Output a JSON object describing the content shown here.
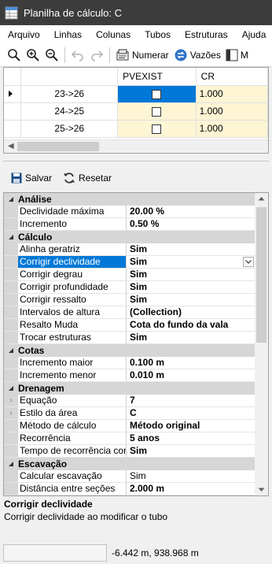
{
  "window": {
    "title": "Planilha de cálculo: C"
  },
  "menu": [
    "Arquivo",
    "Linhas",
    "Colunas",
    "Tubos",
    "Estruturas",
    "Ajuda"
  ],
  "toolbar": {
    "numerar_label": "Numerar",
    "vazoes_label": "Vazões",
    "m_label": "M"
  },
  "grid": {
    "columns": [
      "PVEXIST",
      "CR"
    ],
    "rows": [
      {
        "name": "23->26",
        "cr": "1.000"
      },
      {
        "name": "24->25",
        "cr": "1.000"
      },
      {
        "name": "25->26",
        "cr": "1.000"
      }
    ]
  },
  "actions": {
    "save_label": "Salvar",
    "reset_label": "Resetar"
  },
  "properties": {
    "analise": {
      "title": "Análise",
      "items": [
        {
          "name": "Declividade máxima",
          "value": "20.00 %"
        },
        {
          "name": "Incremento",
          "value": "0.50 %"
        }
      ]
    },
    "calculo": {
      "title": "Cálculo",
      "items": [
        {
          "name": "Alinha geratriz",
          "value": "Sim"
        },
        {
          "name": "Corrigir declividade",
          "value": "Sim"
        },
        {
          "name": "Corrigir degrau",
          "value": "Sim"
        },
        {
          "name": "Corrigir profundidade",
          "value": "Sim"
        },
        {
          "name": "Corrigir ressalto",
          "value": "Sim"
        },
        {
          "name": "Intervalos de altura",
          "value": "(Collection)"
        },
        {
          "name": "Resalto Muda",
          "value": "Cota do fundo da vala"
        },
        {
          "name": "Trocar estruturas",
          "value": "Sim"
        }
      ]
    },
    "cotas": {
      "title": "Cotas",
      "items": [
        {
          "name": "Incremento maior",
          "value": "0.100 m"
        },
        {
          "name": "Incremento menor",
          "value": "0.010 m"
        }
      ]
    },
    "drenagem": {
      "title": "Drenagem",
      "items": [
        {
          "name": "Equação",
          "value": "7"
        },
        {
          "name": "Estilo da área",
          "value": "C"
        },
        {
          "name": "Método de cálculo",
          "value": "Método original"
        },
        {
          "name": "Recorrência",
          "value": "5 anos"
        },
        {
          "name": "Tempo de recorrência cons",
          "value": "Sim"
        }
      ]
    },
    "escavacao": {
      "title": "Escavação",
      "items": [
        {
          "name": "Calcular escavação",
          "value": "Sim"
        },
        {
          "name": "Distância entre seções",
          "value": "2.000 m"
        }
      ]
    }
  },
  "description": {
    "title": "Corrigir declividade",
    "text": "Corrigir declividade ao modificar o tubo"
  },
  "status": {
    "coords": "-6.442 m, 938.968 m"
  }
}
